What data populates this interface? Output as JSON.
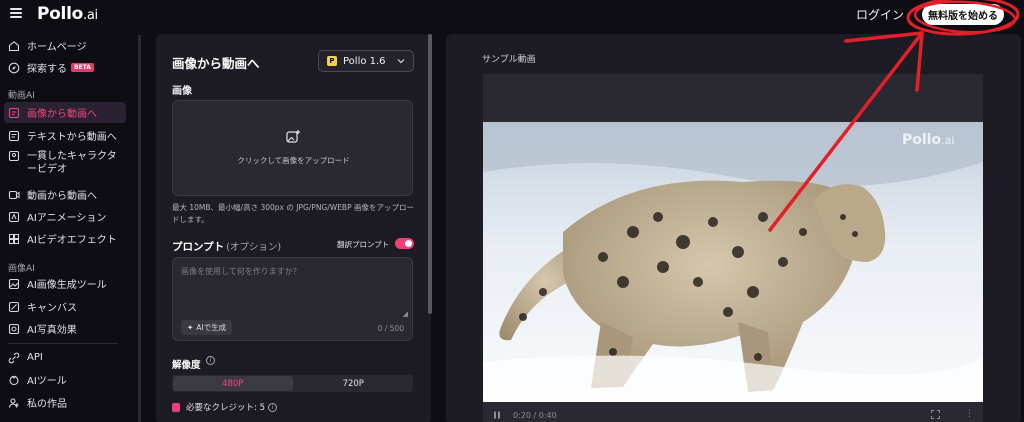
{
  "header": {
    "logo_main": "Pollo",
    "logo_suffix": ".ai",
    "login_label": "ログイン",
    "start_button_label": "無料版を始める"
  },
  "sidebar": {
    "items": [
      {
        "label": "ホームページ",
        "icon": "home-icon"
      },
      {
        "label": "探索する",
        "icon": "compass-icon",
        "badge": "BETA"
      },
      {
        "label": "画像から動画へ",
        "icon": "image-video-icon",
        "active": true
      },
      {
        "label": "テキストから動画へ",
        "icon": "text-video-icon"
      },
      {
        "label": "一貫したキャラクタービデオ",
        "icon": "character-icon"
      },
      {
        "label": "動画から動画へ",
        "icon": "video-video-icon"
      },
      {
        "label": "AIアニメーション",
        "icon": "animation-icon"
      },
      {
        "label": "AIビデオエフェクト",
        "icon": "effects-icon"
      },
      {
        "label": "AI画像生成ツール",
        "icon": "image-gen-icon"
      },
      {
        "label": "キャンバス",
        "icon": "canvas-icon"
      },
      {
        "label": "AI写真効果",
        "icon": "photo-effect-icon"
      },
      {
        "label": "API",
        "icon": "api-icon"
      },
      {
        "label": "AIツール",
        "icon": "tools-icon"
      },
      {
        "label": "私の作品",
        "icon": "works-icon"
      }
    ],
    "section_video": "動画AI",
    "section_image": "画像AI"
  },
  "form": {
    "title": "画像から動画へ",
    "model": "Pollo 1.6",
    "image_label": "画像",
    "upload_text": "クリックして画像をアップロード",
    "upload_hint": "最大 10MB、最小幅/高さ 300px の JPG/PNG/WEBP 画像をアップロードします。",
    "prompt_label": "プロンプト",
    "prompt_optional": "(オプション)",
    "translate_label": "翻訳プロンプト",
    "translate_on": true,
    "prompt_placeholder": "画像を使用して何を作りますか？",
    "ai_generate_label": "AIで生成",
    "char_count": "0 / 500",
    "resolution_label": "解像度",
    "resolution_options": [
      "480P",
      "720P"
    ],
    "resolution_selected": "480P",
    "credits_text": "必要なクレジット: 5"
  },
  "preview": {
    "title": "サンプル動画",
    "watermark_main": "Pollo",
    "watermark_suffix": ".ai",
    "time": "0:20 / 0:40"
  },
  "colors": {
    "accent": "#ef3f78",
    "background": "#0e0d13",
    "panel": "#1d1c24",
    "annotation": "#e3202a"
  }
}
